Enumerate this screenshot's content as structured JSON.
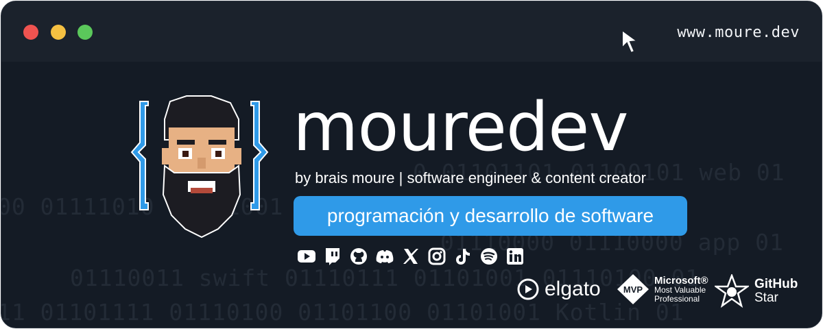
{
  "window": {
    "controls": [
      "close",
      "minimize",
      "maximize"
    ],
    "url": "www.moure.dev",
    "colors": {
      "background": "#141b25",
      "titlebar": "#1b222c",
      "close": "#ef5350",
      "minimize": "#f5c042",
      "maximize": "#5bc85b"
    }
  },
  "background": {
    "lines": [
      "0 01101101 01100101 web 01",
      "00 01111010 01101001 01101100 01111 01",
      "01110000 01110000 app 01",
      "01110011 swift 01110111 01101001 01110100 01",
      "11 01101111 01110100 01101100 01101001 Kotlin 01"
    ]
  },
  "brand": {
    "name": "mouredev",
    "tagline": "by brais moure | software engineer & content creator",
    "pill": "programación y desarrollo de software",
    "accent": "#2f9ae8"
  },
  "socials": [
    "youtube-icon",
    "twitch-icon",
    "github-icon",
    "discord-icon",
    "x-icon",
    "instagram-icon",
    "tiktok-icon",
    "spotify-icon",
    "linkedin-icon"
  ],
  "sponsors": {
    "elgato": {
      "name": "elgato"
    },
    "mvp": {
      "badge": "MVP",
      "line1": "Microsoft®",
      "line2": "Most Valuable",
      "line3": "Professional"
    },
    "github": {
      "line1": "GitHub",
      "line2": "Star"
    }
  }
}
